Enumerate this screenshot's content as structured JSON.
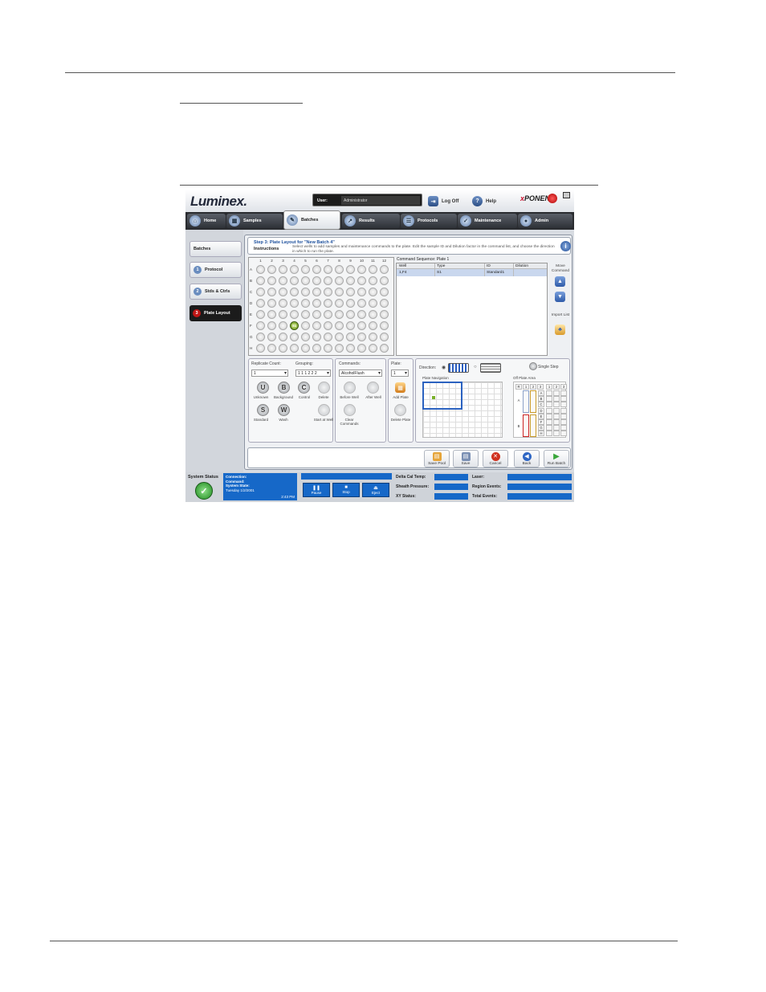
{
  "app": {
    "logo": "Luminex.",
    "user_label": "User:",
    "user_value": "Administrator",
    "log_off": "Log Off",
    "help": "Help",
    "brand_prefix": "x",
    "brand_main": "PONENT",
    "info_icon": "i"
  },
  "nav": {
    "tabs": [
      {
        "label": "Home",
        "icon": "home-icon"
      },
      {
        "label": "Samples",
        "icon": "samples-icon"
      },
      {
        "label": "Batches",
        "icon": "batches-icon"
      },
      {
        "label": "Results",
        "icon": "results-icon"
      },
      {
        "label": "Protocols",
        "icon": "protocols-icon"
      },
      {
        "label": "Maintenance",
        "icon": "maintenance-icon"
      },
      {
        "label": "Admin",
        "icon": "admin-icon"
      }
    ],
    "active": "Batches"
  },
  "sidebar": {
    "items": [
      {
        "label": "Batches",
        "num": ""
      },
      {
        "label": "Protocol",
        "num": "1"
      },
      {
        "label": "Stds & Ctrls",
        "num": "2"
      },
      {
        "label": "Plate Layout",
        "num": "3"
      }
    ]
  },
  "instructions": {
    "step": "Step 3: Plate Layout for \"New Batch 4\"",
    "label": "Instructions",
    "text": "Select wells to add samples and maintenance commands to the plate. Edit the sample ID and Dilution factor in the command list, and choose the direction in which to run the plate."
  },
  "plate": {
    "columns": [
      "1",
      "2",
      "3",
      "4",
      "5",
      "6",
      "7",
      "8",
      "9",
      "10",
      "11",
      "12"
    ],
    "rows": [
      "A",
      "B",
      "C",
      "D",
      "E",
      "F",
      "G",
      "H"
    ],
    "filled_well": {
      "row": "F",
      "col": "4",
      "label": "S1"
    }
  },
  "command_sequence": {
    "title": "Command Sequence: Plate 1",
    "headers": [
      "Well",
      "Type",
      "ID",
      "Dilution"
    ],
    "rows": [
      {
        "well": "1,F4",
        "type": "S1",
        "id": "Standard1",
        "dilution": ""
      }
    ]
  },
  "side_controls": {
    "move_command": "Move Command",
    "import_list": "Import List"
  },
  "replicate": {
    "label": "Replicate Count:",
    "value": "1",
    "grouping_label": "Grouping:",
    "grouping_value": "1 1 1 2 2 2",
    "buttons": [
      {
        "letter": "U",
        "label": "Unknown"
      },
      {
        "letter": "B",
        "label": "Background"
      },
      {
        "letter": "C",
        "label": "Control"
      },
      {
        "letter": "",
        "label": "Delete"
      },
      {
        "letter": "S",
        "label": "Standard"
      },
      {
        "letter": "W",
        "label": "Wash"
      },
      {
        "letter": "",
        "label": "Start at Well"
      }
    ]
  },
  "commands": {
    "label": "Commands:",
    "value": "AlcoholFlush",
    "before": "Before Well",
    "after": "After Well",
    "clear": "Clear Commands"
  },
  "plates": {
    "label": "Plate:",
    "value": "1",
    "add": "Add Plate",
    "delete": "Delete Plate"
  },
  "direction": {
    "label": "Direction:",
    "single_step": "Single Step",
    "plate_navigation": "Plate Navigation",
    "off_plate_area": "Off Plate Area",
    "off_cols": [
      "R",
      "1",
      "2",
      "3",
      "1",
      "2",
      "3"
    ],
    "off_rows_left": [
      "A",
      "B"
    ],
    "off_rows_right": [
      "A",
      "B",
      "C",
      "D",
      "E",
      "F",
      "G",
      "H"
    ]
  },
  "footer": {
    "buttons": [
      {
        "label": "Save Pool",
        "color": "#e6a53a"
      },
      {
        "label": "Save",
        "color": "#7a8fb3"
      },
      {
        "label": "Cancel",
        "color": "#d0311f"
      },
      {
        "label": "Back",
        "color": "#2e66c4"
      },
      {
        "label": "Run Batch",
        "color": "#3aa63a"
      }
    ]
  },
  "status": {
    "label": "System Status",
    "connection": "Connection:",
    "command": "Command:",
    "system_state": "System State:",
    "date": "Tuesday 1/2/2001",
    "time": "2:43 PM",
    "pause": "Pause",
    "stop": "Stop",
    "eject": "Eject",
    "metrics": [
      "Delta Cal Temp:",
      "Sheath Pressure:",
      "XY Status:",
      "Laser:",
      "Region Events:",
      "Total Events:"
    ]
  }
}
